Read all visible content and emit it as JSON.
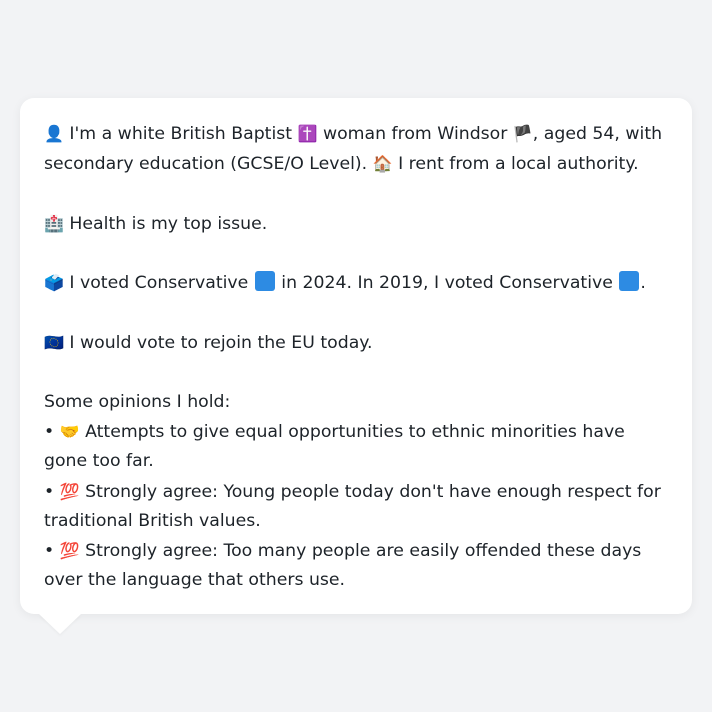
{
  "profile": {
    "identity": {
      "icon": "👤",
      "text1": "I'm a white British Baptist",
      "religion_icon": "✝️",
      "text2": "woman from Windsor",
      "flag_icon": "🏴",
      "text3": ", aged 54, with secondary education (GCSE/O Level).",
      "home_icon": "🏠",
      "text4": "I rent from a local authority."
    },
    "issue": {
      "icon": "🏥",
      "text": "Health is my top issue."
    },
    "vote": {
      "icon": "🗳️",
      "text1": "I voted Conservative",
      "text2": "in 2024. In 2019, I voted Conservative",
      "text3": ".",
      "party_color": "#2d8be3"
    },
    "eu": {
      "icon": "🇪🇺",
      "text": "I would vote to rejoin the EU today."
    },
    "opinions": {
      "heading": "Some opinions I hold:",
      "bullet": "•",
      "items": [
        {
          "icon": "🤝",
          "text": "Attempts to give equal opportunities to ethnic minorities have gone too far."
        },
        {
          "icon": "💯",
          "text": "Strongly agree: Young people today don't have enough respect for traditional British values."
        },
        {
          "icon": "💯",
          "text": "Strongly agree: Too many people are easily offended these days over the language that others use."
        }
      ]
    }
  }
}
